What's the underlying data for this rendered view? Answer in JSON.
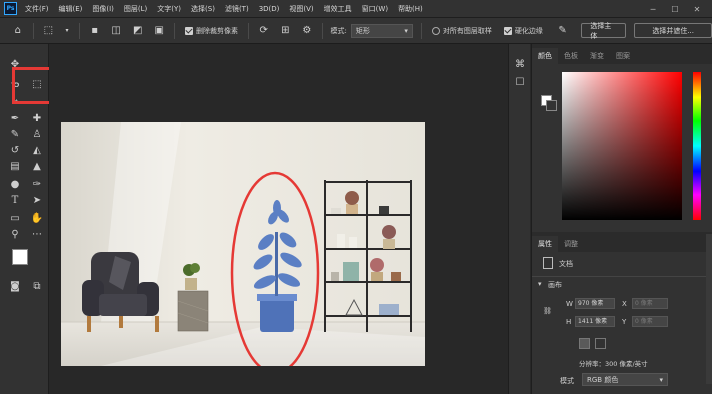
{
  "menubar": {
    "logo": "Ps",
    "items": [
      "文件(F)",
      "编辑(E)",
      "图像(I)",
      "图层(L)",
      "文字(Y)",
      "选择(S)",
      "滤镜(T)",
      "3D(D)",
      "视图(V)",
      "增效工具",
      "窗口(W)",
      "帮助(H)"
    ]
  },
  "options": {
    "delete_cropped": "删除裁剪像素",
    "style_label": "模式:",
    "style_value": "矩形",
    "sample_all_layers": "对所有图层取样",
    "enhance_edge": "硬化边缘",
    "select_subject": "选择主体",
    "select_and_mask": "选择并遮住..."
  },
  "right_panel": {
    "color_tabs": [
      "颜色",
      "色板",
      "渐变",
      "图案"
    ],
    "props_tabs": [
      "属性",
      "调整"
    ],
    "doc_label": "文档",
    "canvas_label": "画布",
    "w_label": "W",
    "w_value": "970 像素",
    "h_label": "H",
    "h_value": "1411 像素",
    "x_label": "X",
    "x_placeholder": "0 像素",
    "y_label": "Y",
    "y_placeholder": "0 像素",
    "resolution": "分辨率：300 像素/英寸",
    "mode_label": "模式",
    "mode_value": "RGB 颜色"
  },
  "colors": {
    "highlight": "#e53935",
    "plant": "#5b7fc4"
  }
}
